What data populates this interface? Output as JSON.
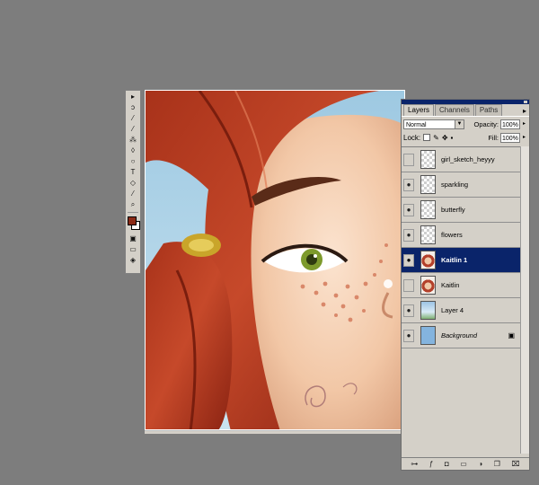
{
  "toolbox": {
    "tools": [
      {
        "name": "move-tool-icon",
        "glyph": "▸"
      },
      {
        "name": "lasso-tool-icon",
        "glyph": "ↄ"
      },
      {
        "name": "wand-tool-icon",
        "glyph": "⁄"
      },
      {
        "name": "brush-tool-icon",
        "glyph": "⁄"
      },
      {
        "name": "stamp-tool-icon",
        "glyph": "⁂"
      },
      {
        "name": "eraser-tool-icon",
        "glyph": "◊"
      },
      {
        "name": "dodge-tool-icon",
        "glyph": "○"
      },
      {
        "name": "type-tool-icon",
        "glyph": "T"
      },
      {
        "name": "pen-tool-icon",
        "glyph": "◇"
      },
      {
        "name": "eyedropper-tool-icon",
        "glyph": "⁄"
      },
      {
        "name": "zoom-tool-icon",
        "glyph": "⌕"
      }
    ],
    "foreground_color": "#8b2a16",
    "background_color": "#ffffff"
  },
  "layers_palette": {
    "tabs": [
      {
        "label": "Layers",
        "active": true
      },
      {
        "label": "Channels",
        "active": false
      },
      {
        "label": "Paths",
        "active": false
      }
    ],
    "menu_glyph": "▸",
    "blend_mode": "Normal",
    "opacity_label": "Opacity:",
    "opacity_value": "100%",
    "lock_label": "Lock:",
    "fill_label": "Fill:",
    "fill_value": "100%",
    "layers": [
      {
        "name": "girl_sketch_heyyy",
        "visible": false,
        "thumb": "checker",
        "selected": false,
        "style": "normal",
        "locked": false
      },
      {
        "name": "sparkling",
        "visible": true,
        "thumb": "checker",
        "selected": false,
        "style": "normal",
        "locked": false
      },
      {
        "name": "butterfly",
        "visible": true,
        "thumb": "checker",
        "selected": false,
        "style": "normal",
        "locked": false
      },
      {
        "name": "flowers",
        "visible": true,
        "thumb": "checker",
        "selected": false,
        "style": "normal",
        "locked": false
      },
      {
        "name": "Kaitlin 1",
        "visible": true,
        "thumb": "portrait",
        "selected": true,
        "style": "bold",
        "locked": false
      },
      {
        "name": "Kaitlin",
        "visible": false,
        "thumb": "portrait",
        "selected": false,
        "style": "normal",
        "locked": false
      },
      {
        "name": "Layer 4",
        "visible": true,
        "thumb": "sky",
        "selected": false,
        "style": "normal",
        "locked": false
      },
      {
        "name": "Background",
        "visible": true,
        "thumb": "blue",
        "selected": false,
        "style": "italic",
        "locked": true
      }
    ],
    "footer_icons": [
      "link-icon",
      "layer-style-icon",
      "mask-icon",
      "new-set-icon",
      "adjustment-layer-icon",
      "new-layer-icon",
      "trash-icon"
    ]
  }
}
